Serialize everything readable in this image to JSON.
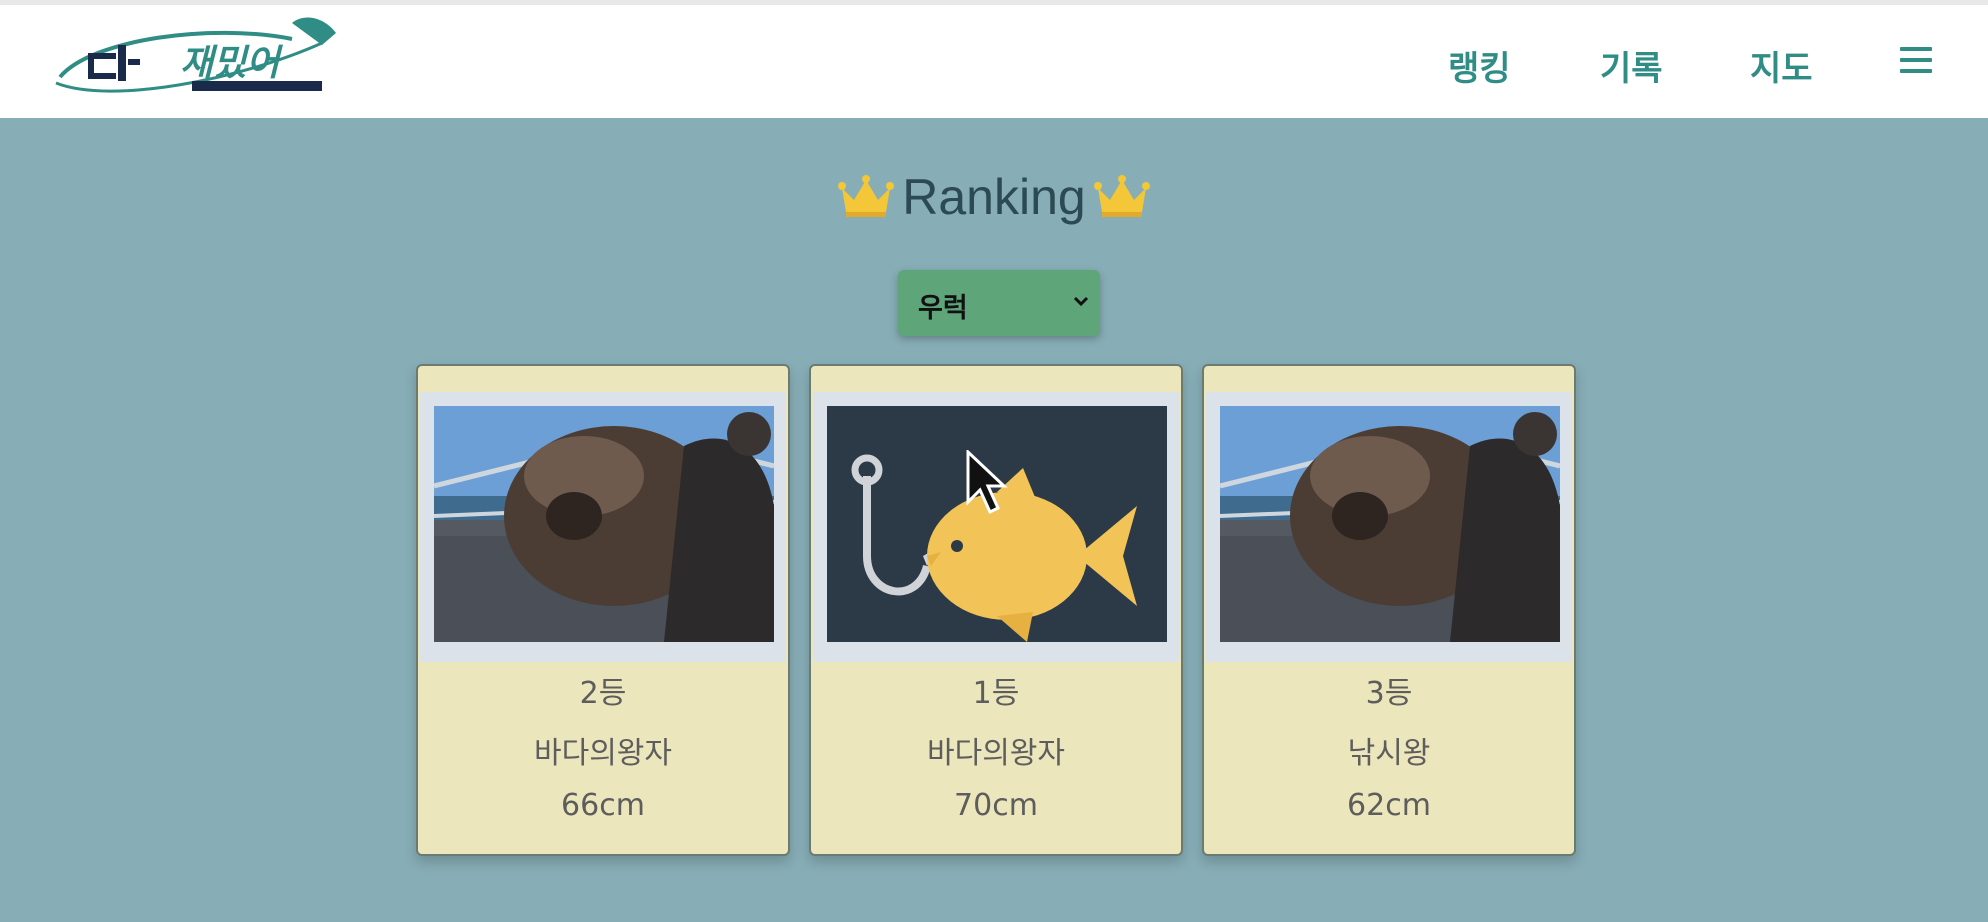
{
  "header": {
    "logo_alt": "다 재밌어",
    "nav": [
      "랭킹",
      "기록",
      "지도"
    ],
    "menu_icon": "hamburger-icon"
  },
  "page": {
    "title": "Ranking",
    "title_icon": "crown-icon"
  },
  "filter": {
    "selected": "우럭"
  },
  "cards": [
    {
      "rank": "2등",
      "nickname": "바다의왕자",
      "size": "66cm",
      "photo": "fish-catch-photo"
    },
    {
      "rank": "1등",
      "nickname": "바다의왕자",
      "size": "70cm",
      "photo": "fish-hook-illustration"
    },
    {
      "rank": "3등",
      "nickname": "낚시왕",
      "size": "62cm",
      "photo": "fish-catch-photo"
    }
  ],
  "colors": {
    "background": "#87adb6",
    "navbar": "#ffffff",
    "nav_text": "#2f8d86",
    "select": "#5fa57a",
    "card": "#ebe6bb",
    "crown": "#f3c738"
  }
}
